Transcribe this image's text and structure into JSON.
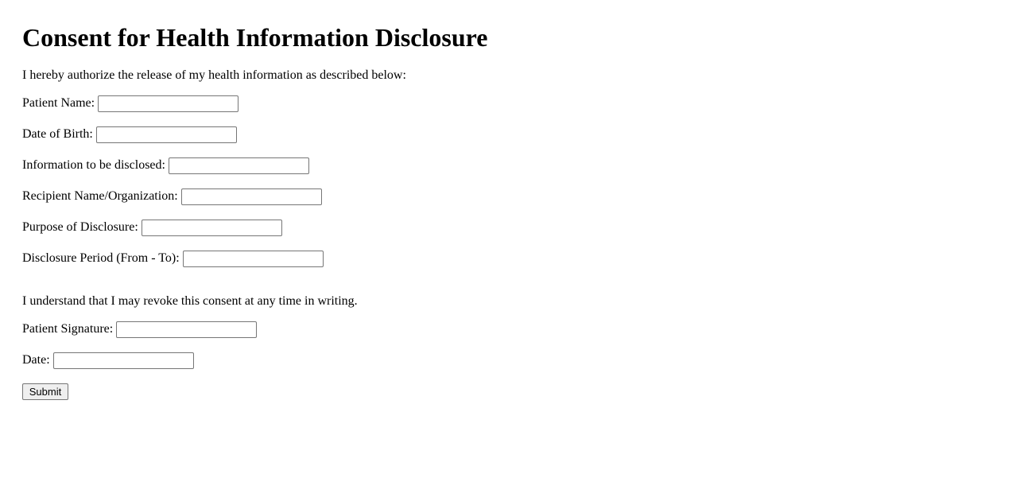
{
  "title": "Consent for Health Information Disclosure",
  "intro_text": "I hereby authorize the release of my health information as described below:",
  "fields": {
    "patient_name": {
      "label": "Patient Name:",
      "value": ""
    },
    "date_of_birth": {
      "label": "Date of Birth:",
      "value": ""
    },
    "information_disclosed": {
      "label": "Information to be disclosed:",
      "value": ""
    },
    "recipient": {
      "label": "Recipient Name/Organization:",
      "value": ""
    },
    "purpose": {
      "label": "Purpose of Disclosure:",
      "value": ""
    },
    "period": {
      "label": "Disclosure Period (From - To):",
      "value": ""
    },
    "signature": {
      "label": "Patient Signature:",
      "value": ""
    },
    "date": {
      "label": "Date:",
      "value": ""
    }
  },
  "revoke_text": "I understand that I may revoke this consent at any time in writing.",
  "submit_label": "Submit"
}
